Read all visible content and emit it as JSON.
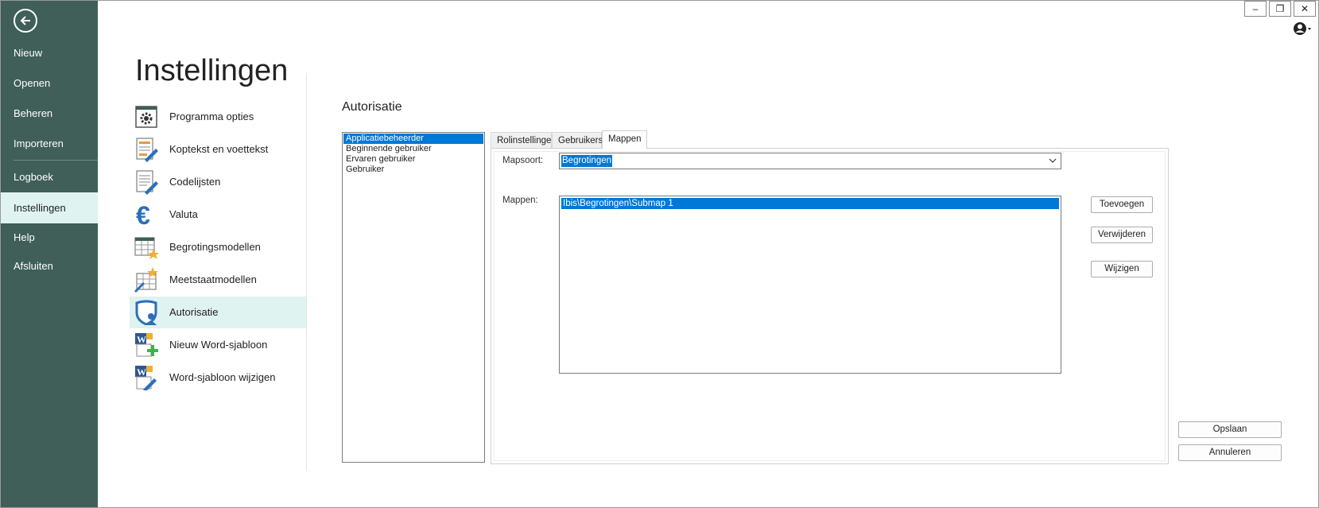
{
  "nav": {
    "items": [
      {
        "label": "Nieuw"
      },
      {
        "label": "Openen"
      },
      {
        "label": "Beheren"
      },
      {
        "label": "Importeren"
      },
      {
        "label": "Logboek"
      },
      {
        "label": "Instellingen"
      },
      {
        "label": "Help"
      },
      {
        "label": "Afsluiten"
      }
    ],
    "active": "Instellingen"
  },
  "window": {
    "minimize": "–",
    "restore": "❐",
    "close": "✕"
  },
  "page": {
    "title": "Instellingen"
  },
  "settings": {
    "items": [
      {
        "label": "Programma opties",
        "icon": "gear-icon"
      },
      {
        "label": "Koptekst en voettekst",
        "icon": "document-edit-icon"
      },
      {
        "label": "Codelijsten",
        "icon": "list-edit-icon"
      },
      {
        "label": "Valuta",
        "icon": "euro-icon"
      },
      {
        "label": "Begrotingsmodellen",
        "icon": "table-star-icon"
      },
      {
        "label": "Meetstaatmodellen",
        "icon": "grid-star-icon"
      },
      {
        "label": "Autorisatie",
        "icon": "shield-user-icon"
      },
      {
        "label": "Nieuw Word-sjabloon",
        "icon": "word-add-icon"
      },
      {
        "label": "Word-sjabloon wijzigen",
        "icon": "word-edit-icon"
      }
    ],
    "active": "Autorisatie"
  },
  "section": {
    "title": "Autorisatie"
  },
  "roles": {
    "items": [
      "Applicatiebeheerder",
      "Beginnende gebruiker",
      "Ervaren gebruiker",
      "Gebruiker"
    ],
    "selected": "Applicatiebeheerder"
  },
  "tabs": {
    "items": [
      "Rolinstellingen",
      "Gebruikers",
      "Mappen"
    ],
    "active": "Mappen"
  },
  "mappen": {
    "mapsoort_label": "Mapsoort:",
    "mapsoort_value": "Begrotingen",
    "mappen_label": "Mappen:",
    "items": [
      "Ibis\\Begrotingen\\Submap 1"
    ],
    "buttons": {
      "add": "Toevoegen",
      "remove": "Verwijderen",
      "edit": "Wijzigen"
    }
  },
  "footer": {
    "save": "Opslaan",
    "cancel": "Annuleren"
  },
  "colors": {
    "nav_bg": "#3f5f58",
    "active_bg": "#dff3f0",
    "selection": "#0078d7"
  }
}
